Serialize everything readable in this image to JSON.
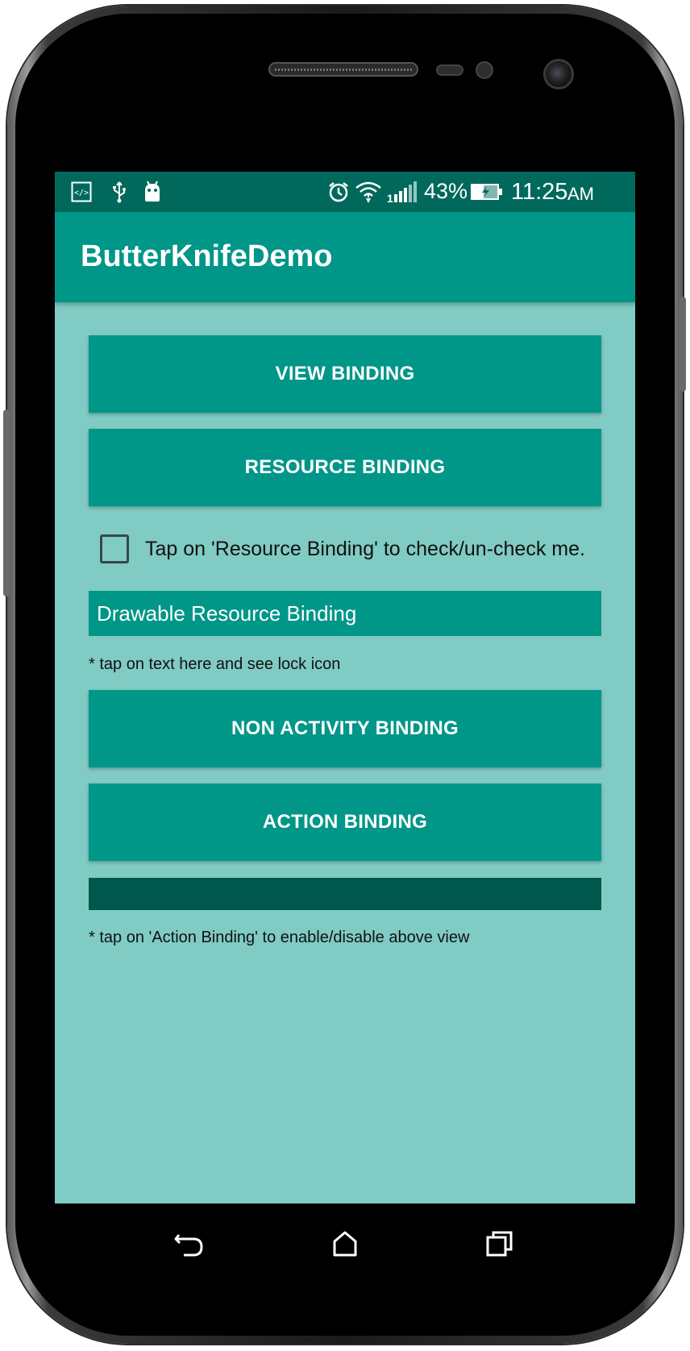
{
  "status_bar": {
    "battery_percent": "43%",
    "time": "11:25",
    "ampm": "AM",
    "icons": [
      "code-icon",
      "usb-icon",
      "android-debug-icon",
      "alarm-icon",
      "wifi-icon",
      "signal-icon",
      "battery-charging-icon"
    ]
  },
  "app_bar": {
    "title": "ButterKnifeDemo"
  },
  "main": {
    "view_binding_label": "VIEW BINDING",
    "resource_binding_label": "RESOURCE BINDING",
    "checkbox_label": "Tap on 'Resource Binding' to check/un-check me.",
    "checkbox_checked": false,
    "drawable_field_text": "Drawable Resource Binding",
    "drawable_hint": "* tap on text here and see lock icon",
    "non_activity_binding_label": "NON ACTIVITY BINDING",
    "action_binding_label": "ACTION BINDING",
    "action_hint": "* tap on 'Action Binding' to enable/disable above view"
  },
  "nav_bar": {
    "icons": [
      "back-icon",
      "home-icon",
      "recents-icon"
    ]
  },
  "colors": {
    "status_bar": "#00695c",
    "primary": "#009688",
    "background": "#80cbc4",
    "disabled_view": "#00574b"
  }
}
